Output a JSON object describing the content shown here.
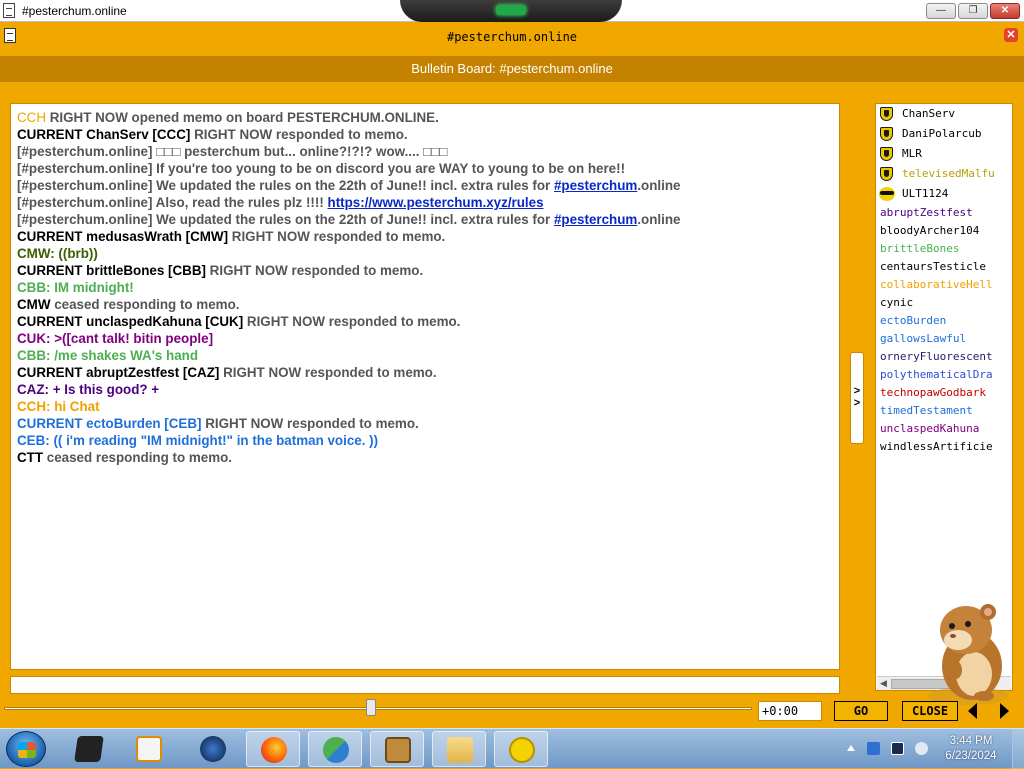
{
  "window": {
    "title": "#pesterchum.online",
    "minimize_label": "—",
    "maximize_label": "❐",
    "close_label": "✕"
  },
  "memo": {
    "title": "#pesterchum.online",
    "close_label": "✕",
    "banner": "Bulletin Board: #pesterchum.online"
  },
  "colors": {
    "frame": "#f0a800",
    "banner": "#c48200",
    "link": "#0a28c8"
  },
  "chat": [
    {
      "parts": [
        {
          "t": "CCH",
          "c": "#f0a000",
          "b": false
        },
        {
          "t": " RIGHT NOW opened memo on board PESTERCHUM.ONLINE.",
          "c": "#555555"
        }
      ]
    },
    {
      "parts": [
        {
          "t": "CURRENT ChanServ [CCC]",
          "c": "#000000"
        },
        {
          "t": " RIGHT NOW responded to memo.",
          "c": "#555555"
        }
      ]
    },
    {
      "parts": [
        {
          "t": "[#pesterchum.online]",
          "c": "#555555"
        },
        {
          "t": " □□□ pesterchum but... online?!?!? wow.... □□□",
          "c": "#555555"
        }
      ]
    },
    {
      "parts": [
        {
          "t": "[#pesterchum.online]",
          "c": "#555555"
        },
        {
          "t": " If you're too young to be on discord you are WAY to young to be on here!!",
          "c": "#555555"
        }
      ]
    },
    {
      "parts": [
        {
          "t": "[#pesterchum.online]",
          "c": "#555555"
        },
        {
          "t": " We updated the rules on the 22th of June!! incl. extra rules for ",
          "c": "#555555"
        },
        {
          "t": "#pesterchum",
          "c": "#0a28c8",
          "link": true
        },
        {
          "t": ".online",
          "c": "#555555"
        }
      ]
    },
    {
      "parts": [
        {
          "t": "[#pesterchum.online]",
          "c": "#555555"
        },
        {
          "t": " Also, read the rules plz !!!! ",
          "c": "#555555"
        },
        {
          "t": "https://www.pesterchum.xyz/rules",
          "c": "#0a28c8",
          "link": true
        }
      ]
    },
    {
      "parts": [
        {
          "t": "[#pesterchum.online]",
          "c": "#555555"
        },
        {
          "t": " We updated the rules on the 22th of June!! incl. extra rules for ",
          "c": "#555555"
        },
        {
          "t": "#pesterchum",
          "c": "#0a28c8",
          "link": true
        },
        {
          "t": ".online",
          "c": "#555555"
        }
      ]
    },
    {
      "parts": [
        {
          "t": "CURRENT medusasWrath [CMW]",
          "c": "#000000"
        },
        {
          "t": " RIGHT NOW responded to memo.",
          "c": "#555555"
        }
      ]
    },
    {
      "parts": [
        {
          "t": "CMW: ((brb))",
          "c": "#3b5f00"
        }
      ]
    },
    {
      "parts": [
        {
          "t": "CURRENT brittleBones [CBB]",
          "c": "#000000"
        },
        {
          "t": " RIGHT NOW responded to memo.",
          "c": "#555555"
        }
      ]
    },
    {
      "parts": [
        {
          "t": "CBB: IM midnight!",
          "c": "#4caf50"
        }
      ]
    },
    {
      "parts": [
        {
          "t": "CMW",
          "c": "#000000"
        },
        {
          "t": " ceased responding to memo.",
          "c": "#555555"
        }
      ]
    },
    {
      "parts": [
        {
          "t": "CURRENT unclaspedKahuna [CUK]",
          "c": "#000000"
        },
        {
          "t": " RIGHT NOW responded to memo.",
          "c": "#555555"
        }
      ]
    },
    {
      "parts": [
        {
          "t": "CUK: >([cant talk! bitin people]",
          "c": "#800080"
        }
      ]
    },
    {
      "parts": [
        {
          "t": "CBB: /me shakes WA's hand",
          "c": "#4caf50"
        }
      ]
    },
    {
      "parts": [
        {
          "t": "CURRENT abruptZestfest [CAZ]",
          "c": "#000000"
        },
        {
          "t": " RIGHT NOW responded to memo.",
          "c": "#555555"
        }
      ]
    },
    {
      "parts": [
        {
          "t": "CAZ: + Is this good? +",
          "c": "#4b0082"
        }
      ]
    },
    {
      "parts": [
        {
          "t": "CCH: hi Chat",
          "c": "#f0a000"
        }
      ]
    },
    {
      "parts": [
        {
          "t": "CURRENT ectoBurden [CEB]",
          "c": "#1e6fd9"
        },
        {
          "t": " RIGHT NOW responded to memo.",
          "c": "#555555"
        }
      ]
    },
    {
      "parts": [
        {
          "t": "CEB: (( i'm reading \"IM midnight!\" in the batman voice. ))",
          "c": "#1e6fd9"
        }
      ]
    },
    {
      "parts": [
        {
          "t": "CTT",
          "c": "#000000"
        },
        {
          "t": " ceased responding to memo.",
          "c": "#555555"
        }
      ]
    }
  ],
  "expand_label": ">\n>",
  "users": [
    {
      "name": "ChanServ",
      "color": "#000000",
      "badge": "shield"
    },
    {
      "name": "DaniPolarcub",
      "color": "#000000",
      "badge": "shield"
    },
    {
      "name": "MLR",
      "color": "#000000",
      "badge": "shield"
    },
    {
      "name": "televisedMalfu",
      "color": "#b8a000",
      "badge": "shield"
    },
    {
      "name": "ULT1124",
      "color": "#000000",
      "badge": "smiley"
    },
    {
      "name": "abruptZestfest",
      "color": "#4b0082",
      "badge": ""
    },
    {
      "name": "bloodyArcher104",
      "color": "#000000",
      "badge": ""
    },
    {
      "name": "brittleBones",
      "color": "#4caf50",
      "badge": ""
    },
    {
      "name": "centaursTesticle",
      "color": "#000000",
      "badge": ""
    },
    {
      "name": "collaborativeHell",
      "color": "#f0a000",
      "badge": ""
    },
    {
      "name": "cynic",
      "color": "#000000",
      "badge": ""
    },
    {
      "name": "ectoBurden",
      "color": "#1e6fd9",
      "badge": ""
    },
    {
      "name": "gallowsLawful",
      "color": "#1e6fd9",
      "badge": ""
    },
    {
      "name": "orneryFluorescent",
      "color": "#2a1a6a",
      "badge": ""
    },
    {
      "name": "polythematicalDra",
      "color": "#2a4fd0",
      "badge": ""
    },
    {
      "name": "technopawGodbark",
      "color": "#c00000",
      "badge": ""
    },
    {
      "name": "timedTestament",
      "color": "#1e6fd9",
      "badge": ""
    },
    {
      "name": "unclaspedKahuna",
      "color": "#800080",
      "badge": ""
    },
    {
      "name": "windlessArtificie",
      "color": "#000000",
      "badge": ""
    }
  ],
  "input": {
    "value": "",
    "placeholder": ""
  },
  "timeline": {
    "offset_label": "+0:00",
    "position_fraction": 0.49
  },
  "buttons": {
    "go": "GO",
    "close": "CLOSE"
  },
  "taskbar": {
    "items": [
      "start-orb",
      "terminal-icon",
      "media-player-icon",
      "globe-icon",
      "firefox-icon",
      "users-icon",
      "box-app-icon",
      "folder-icon",
      "pesterchum-icon"
    ],
    "clock_time": "3:44 PM",
    "clock_date": "6/23/2024"
  }
}
